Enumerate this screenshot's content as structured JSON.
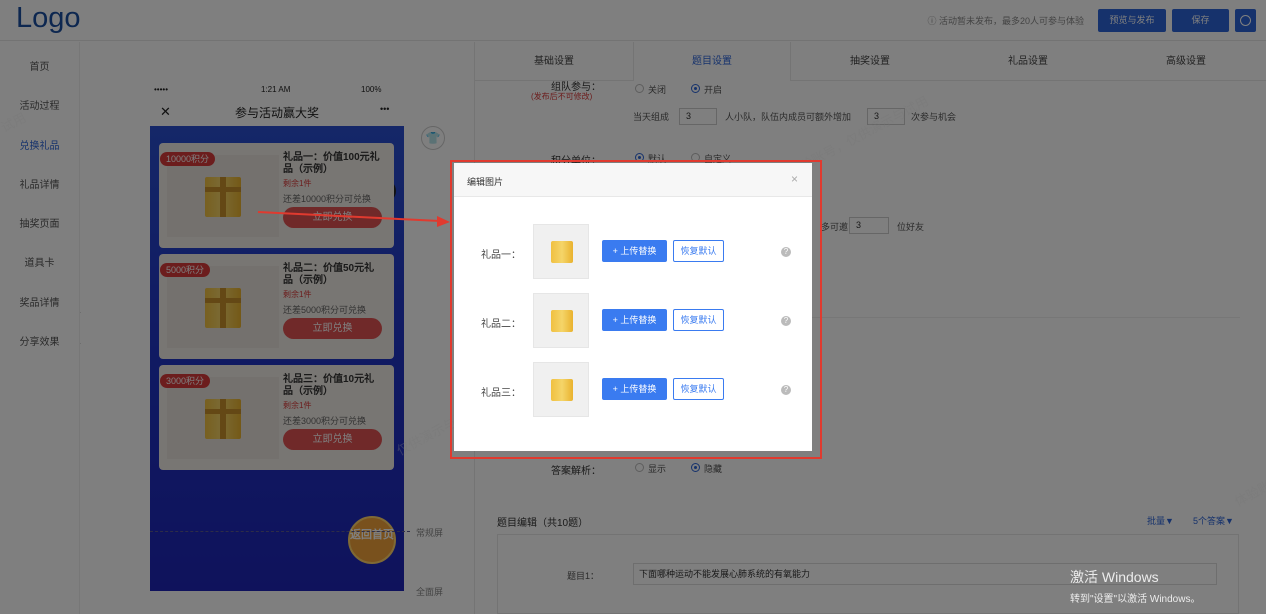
{
  "header": {
    "logo": "Logo",
    "notice": "ⓘ 活动暂未发布，最多20人可参与体验",
    "preview_publish": "预览与发布",
    "save": "保存"
  },
  "sidebar": {
    "items": [
      {
        "label": "首页"
      },
      {
        "label": "活动过程"
      },
      {
        "label": "兑换礼品",
        "active": true
      },
      {
        "label": "礼品详情"
      },
      {
        "label": "抽奖页面"
      },
      {
        "label": "道具卡"
      },
      {
        "label": "奖品详情"
      },
      {
        "label": "分享效果"
      }
    ],
    "collapse": "«"
  },
  "phone": {
    "signal": "•••••",
    "time": "1:21 AM",
    "battery": "100%",
    "close": "✕",
    "title": "参与活动赢大奖",
    "more": "•••",
    "prizes": [
      {
        "points": "10000积分",
        "name": "礼品一：价值100元礼品（示例）",
        "left": "剩余1件",
        "need": "还差10000积分可兑换",
        "btn": "立即兑换"
      },
      {
        "points": "5000积分",
        "name": "礼品二：价值50元礼品（示例）",
        "left": "剩余1件",
        "need": "还差5000积分可兑换",
        "btn": "立即兑换"
      },
      {
        "points": "3000积分",
        "name": "礼品三：价值10元礼品（示例）",
        "left": "剩余1件",
        "need": "还差3000积分可兑换",
        "btn": "立即兑换"
      }
    ],
    "return_home": "返回首页",
    "normal_screen": "常规屏",
    "full_screen": "全面屏"
  },
  "tabs": [
    "基础设置",
    "题目设置",
    "抽奖设置",
    "礼品设置",
    "高级设置"
  ],
  "active_tab": "题目设置",
  "form": {
    "team_label": "组队参与：",
    "team_note": "(发布后不可修改)",
    "close_opt": "关闭",
    "open_opt": "开启",
    "team_text_a": "当天组成",
    "team_num": "3",
    "team_text_b": "人小队，队伍内成员可额外增加",
    "team_extra": "3",
    "team_text_c": "次参与机会",
    "points_label": "积分单位：",
    "points_default": "默认",
    "points_custom": "自定义",
    "invite_text": "多可邀",
    "invite_num": "3",
    "invite_unit": "位好友",
    "analysis_label": "答案解析：",
    "analysis_show": "显示",
    "analysis_hide": "隐藏",
    "section_title": "题目编辑（共10题）",
    "batch": "批量▼",
    "answers": "5个答案▼",
    "q1_label": "题目1：",
    "q1_value": "下面哪种运动不能发展心肺系统的有氧能力"
  },
  "modal": {
    "title": "编辑图片",
    "close": "×",
    "rows": [
      {
        "label": "礼品一：",
        "upload": "+ 上传替换",
        "restore": "恢复默认"
      },
      {
        "label": "礼品二：",
        "upload": "+ 上传替换",
        "restore": "恢复默认"
      },
      {
        "label": "礼品三：",
        "upload": "+ 上传替换",
        "restore": "恢复默认"
      }
    ],
    "help": "?"
  },
  "watermarks": [
    "仅供演示与试用",
    "体验账号，仅供演示与试用",
    "体验账号",
    "试用"
  ],
  "windows": {
    "line1": "激活 Windows",
    "line2": "转到\"设置\"以激活 Windows。"
  },
  "colors": {
    "primary": "#2d65d8",
    "highlight_frame": "#e03a2f",
    "phone_bg": "#2238c8"
  }
}
